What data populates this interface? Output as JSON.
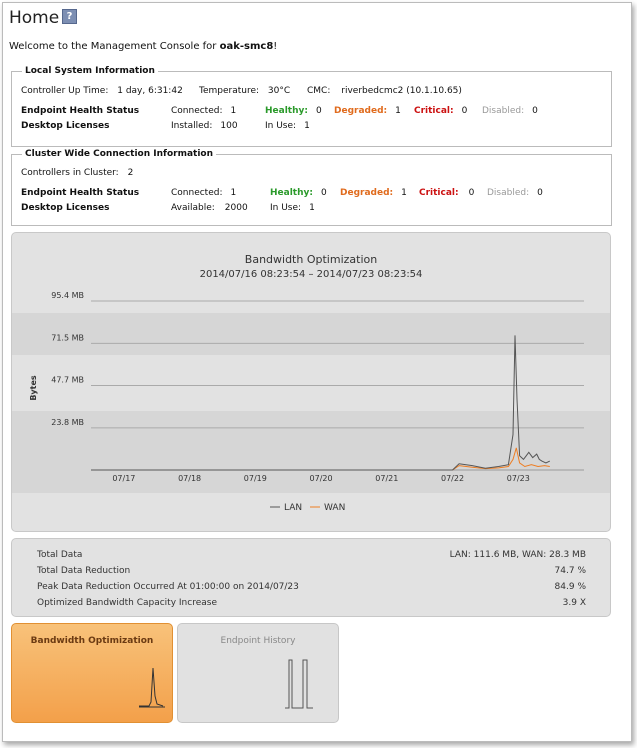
{
  "page": {
    "title": "Home",
    "help_icon": "?",
    "welcome_prefix": "Welcome to the Management Console for",
    "host": "oak-smc8",
    "welcome_suffix": "!"
  },
  "local": {
    "legend": "Local System Information",
    "uptime_label": "Controller Up Time:",
    "uptime_value": "1 day, 6:31:42",
    "temp_label": "Temperature:",
    "temp_value": "30°C",
    "cmc_label": "CMC:",
    "cmc_value": "riverbedcmc2 (10.1.10.65)",
    "endpoint_label": "Endpoint Health Status",
    "connected_label": "Connected:",
    "connected_value": "1",
    "healthy_label": "Healthy:",
    "healthy_value": "0",
    "degraded_label": "Degraded:",
    "degraded_value": "1",
    "critical_label": "Critical:",
    "critical_value": "0",
    "disabled_label": "Disabled:",
    "disabled_value": "0",
    "licenses_label": "Desktop Licenses",
    "installed_label": "Installed:",
    "installed_value": "100",
    "inuse_label": "In Use:",
    "inuse_value": "1"
  },
  "cluster": {
    "legend": "Cluster Wide Connection Information",
    "controllers_label": "Controllers in Cluster:",
    "controllers_value": "2",
    "endpoint_label": "Endpoint Health Status",
    "connected_label": "Connected:",
    "connected_value": "1",
    "healthy_label": "Healthy:",
    "healthy_value": "0",
    "degraded_label": "Degraded:",
    "degraded_value": "1",
    "critical_label": "Critical:",
    "critical_value": "0",
    "disabled_label": "Disabled:",
    "disabled_value": "0",
    "licenses_label": "Desktop Licenses",
    "available_label": "Available:",
    "available_value": "2000",
    "inuse_label": "In Use:",
    "inuse_value": "1"
  },
  "chart_data": {
    "type": "line",
    "title": "Bandwidth Optimization",
    "subtitle": "2014/07/16 08:23:54 – 2014/07/23 08:23:54",
    "ylabel": "Bytes",
    "ylim": [
      0,
      95.4
    ],
    "yticks": [
      {
        "value": 23.8,
        "label": "23.8 MB"
      },
      {
        "value": 47.7,
        "label": "47.7 MB"
      },
      {
        "value": 71.5,
        "label": "71.5 MB"
      },
      {
        "value": 95.4,
        "label": "95.4 MB"
      }
    ],
    "xlim": [
      0,
      7.5
    ],
    "xticks": [
      {
        "value": 0.5,
        "label": "07/17"
      },
      {
        "value": 1.5,
        "label": "07/18"
      },
      {
        "value": 2.5,
        "label": "07/19"
      },
      {
        "value": 3.5,
        "label": "07/20"
      },
      {
        "value": 4.5,
        "label": "07/21"
      },
      {
        "value": 5.5,
        "label": "07/22"
      },
      {
        "value": 6.5,
        "label": "07/23"
      }
    ],
    "series": [
      {
        "name": "LAN",
        "color": "#555555",
        "x": [
          0,
          5.5,
          5.6,
          5.8,
          6.0,
          6.2,
          6.35,
          6.42,
          6.45,
          6.48,
          6.52,
          6.58,
          6.62,
          6.66,
          6.72,
          6.78,
          6.82,
          6.86,
          6.92,
          6.98
        ],
        "y": [
          0,
          0,
          3.5,
          2.5,
          1.0,
          2.0,
          3.0,
          20.0,
          76.0,
          40.0,
          8.0,
          6.0,
          8.0,
          10.0,
          7.0,
          9.0,
          6.0,
          5.0,
          4.0,
          5.0
        ]
      },
      {
        "name": "WAN",
        "color": "#ee7d22",
        "x": [
          0,
          5.5,
          5.6,
          5.8,
          6.0,
          6.2,
          6.35,
          6.42,
          6.47,
          6.52,
          6.6,
          6.7,
          6.8,
          6.9,
          6.98
        ],
        "y": [
          0,
          0,
          2.5,
          1.5,
          0.8,
          1.2,
          2.0,
          6.0,
          12.5,
          4.0,
          2.0,
          3.0,
          2.0,
          2.5,
          2.0
        ]
      }
    ],
    "legend_position": "bottom"
  },
  "stats": [
    {
      "label": "Total Data",
      "value": "LAN: 111.6 MB, WAN: 28.3 MB"
    },
    {
      "label": "Total Data Reduction",
      "value": "74.7 %"
    },
    {
      "label": "Peak Data Reduction Occurred At 01:00:00 on 2014/07/23",
      "value": "84.9 %"
    },
    {
      "label": "Optimized Bandwidth Capacity Increase",
      "value": "3.9 X"
    }
  ],
  "tiles": {
    "bandwidth": {
      "label": "Bandwidth Optimization"
    },
    "endpoint": {
      "label": "Endpoint History"
    }
  },
  "colors": {
    "accent": "#f3a04a",
    "healthy": "#2b9a2b",
    "degraded": "#e06b1d",
    "critical": "#cc1111"
  }
}
